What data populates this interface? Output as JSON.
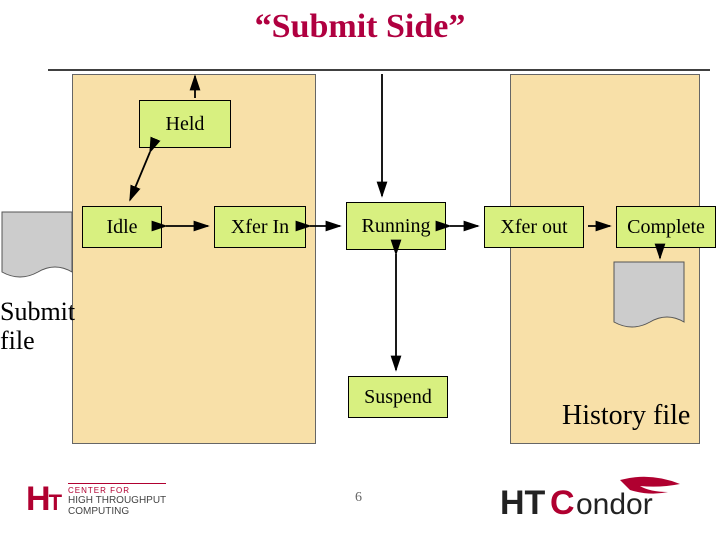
{
  "title": "“Submit Side”",
  "states": {
    "held": "Held",
    "idle": "Idle",
    "xfer_in": "Xfer In",
    "running": "Running",
    "xfer_out": "Xfer out",
    "complete": "Complete",
    "suspend": "Suspend"
  },
  "labels": {
    "submit_file": "Submit file",
    "history_file": "History file"
  },
  "page_number": "6",
  "logos": {
    "left_line1": "CENTER FOR",
    "left_line2": "HIGH THROUGHPUT",
    "left_line3": "COMPUTING",
    "right": "HTCondor"
  },
  "colors": {
    "title": "#b00040",
    "panel": "#f8e0a8",
    "state": "#d8f080"
  }
}
